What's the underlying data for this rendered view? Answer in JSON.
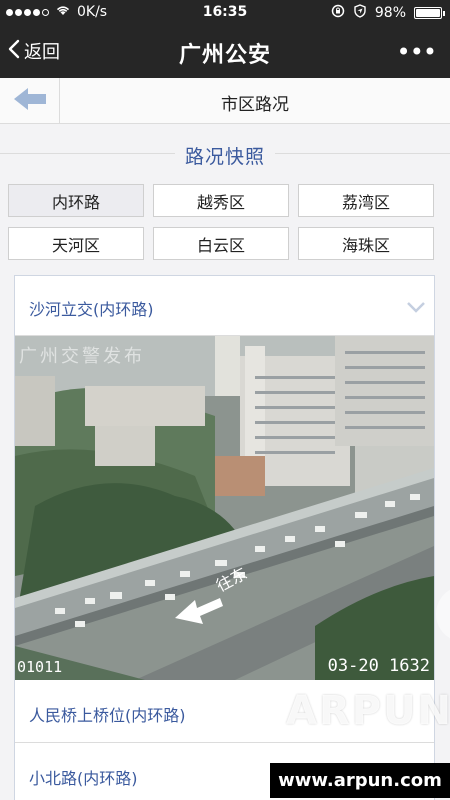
{
  "status_bar": {
    "carrier": "0K/s",
    "time": "16:35",
    "battery": "98%",
    "battery_level": 0.98,
    "icons": [
      "signal-dots-icon",
      "wifi-icon",
      "rotation-lock-icon",
      "location-icon",
      "battery-icon"
    ]
  },
  "nav": {
    "back_label": "返回",
    "title": "广州公安",
    "more_label": "•••"
  },
  "page": {
    "title": "市区路况"
  },
  "section": {
    "title": "路况快照"
  },
  "districts": [
    {
      "label": "内环路",
      "active": true
    },
    {
      "label": "越秀区",
      "active": false
    },
    {
      "label": "荔湾区",
      "active": false
    },
    {
      "label": "天河区",
      "active": false
    },
    {
      "label": "白云区",
      "active": false
    },
    {
      "label": "海珠区",
      "active": false
    }
  ],
  "cameras": {
    "expanded": {
      "label": "沙河立交(内环路)",
      "image": {
        "watermark": "广州交警发布",
        "camera_id": "01011",
        "timestamp": "03-20 1632",
        "direction_text": "往东"
      }
    },
    "items": [
      {
        "label": "人民桥上桥位(内环路)"
      },
      {
        "label": "小北路(内环路)"
      }
    ]
  },
  "watermark": {
    "brand": "ARPUN",
    "url": "www.arpun.com"
  },
  "colors": {
    "bar": "#262626",
    "accent": "#3b5a9e",
    "back_arrow": "#9fb6d6"
  }
}
